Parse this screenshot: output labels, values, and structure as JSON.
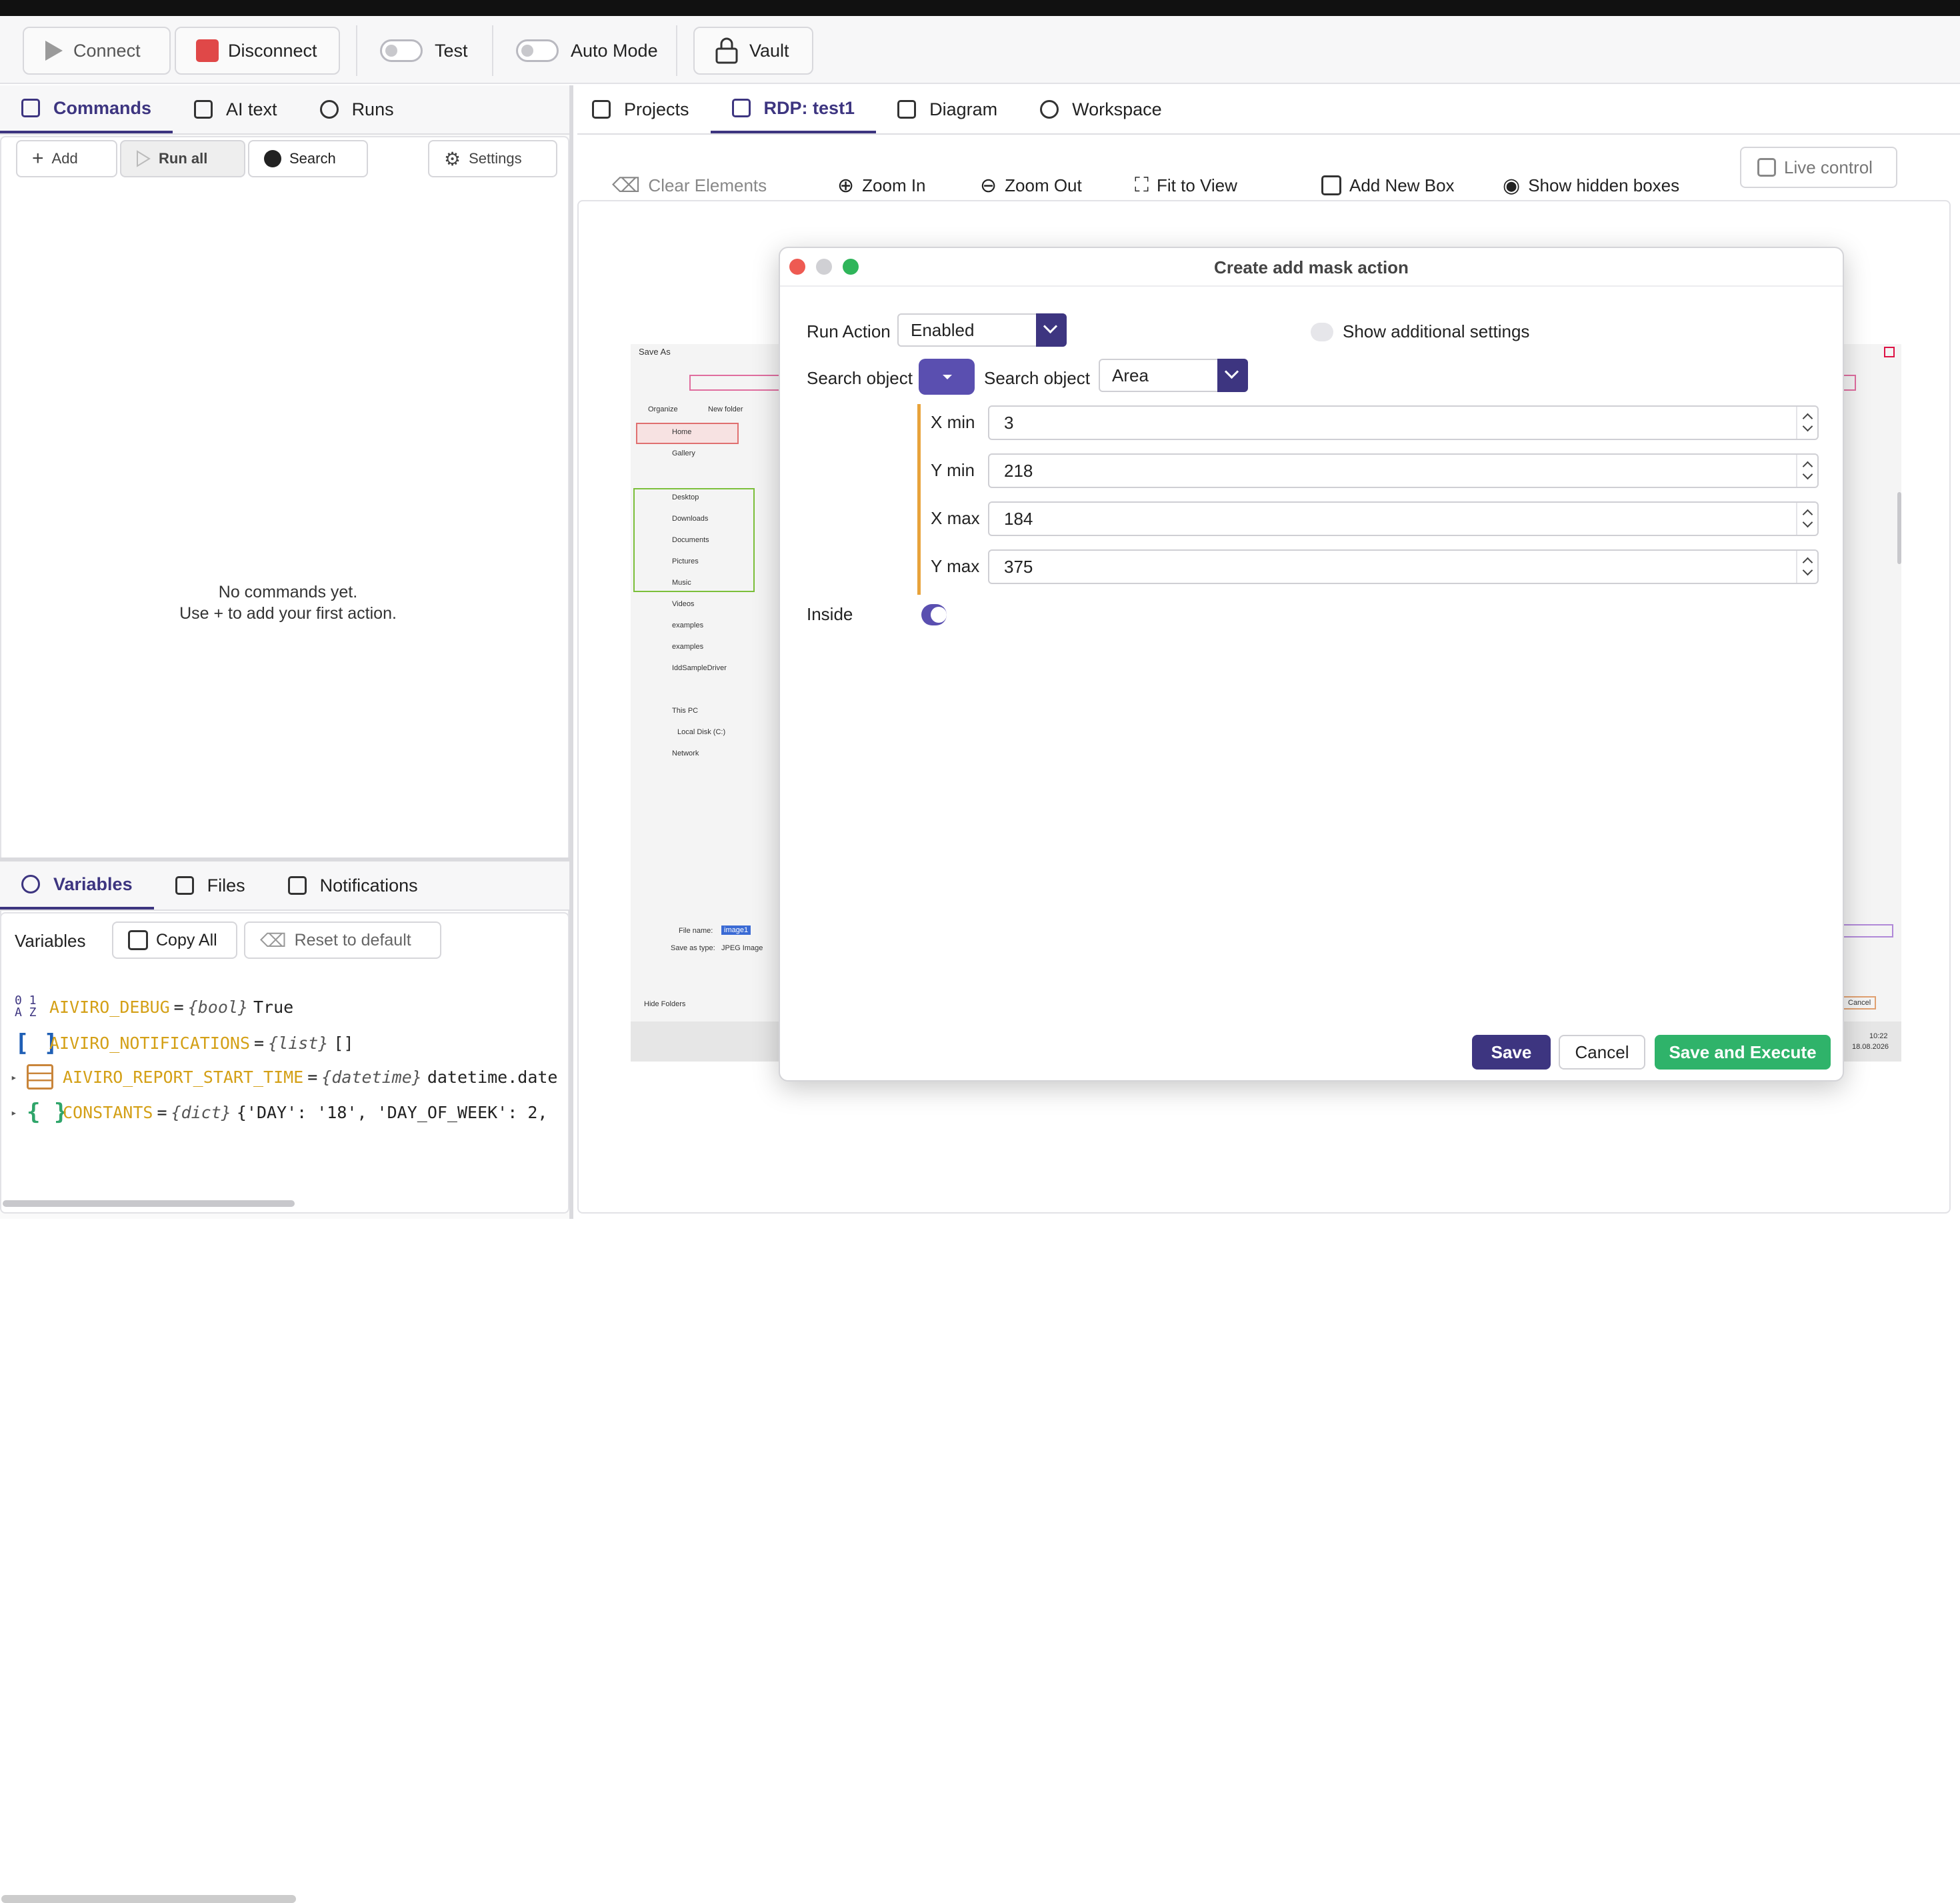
{
  "toolbar": {
    "connect": "Connect",
    "disconnect": "Disconnect",
    "test": "Test",
    "auto_mode": "Auto Mode",
    "vault": "Vault"
  },
  "left_tabs": [
    "Commands",
    "AI text",
    "Runs"
  ],
  "commands_toolbar": {
    "add": "Add",
    "run_all": "Run all",
    "search": "Search",
    "settings": "Settings"
  },
  "commands_empty": [
    "No commands yet.",
    "Use + to add your first action."
  ],
  "bottom_tabs": [
    "Variables",
    "Files",
    "Notifications"
  ],
  "variables_bar": {
    "label": "Variables",
    "copy_all": "Copy All",
    "reset": "Reset to default"
  },
  "variables": [
    {
      "icon": "0 1 A Z",
      "name": "AIVIRO_DEBUG",
      "eq": "=",
      "type": "{bool}",
      "value": "True",
      "color": "#d4a017"
    },
    {
      "icon": "[ ]",
      "name": "AIVIRO_NOTIFICATIONS",
      "eq": "=",
      "type": "{list}",
      "value": "[]",
      "color": "#d4a017"
    },
    {
      "icon": "table-icon",
      "name": "AIVIRO_REPORT_START_TIME",
      "eq": "=",
      "type": "{datetime}",
      "value": "datetime.date",
      "color": "#d4a017"
    },
    {
      "icon": "{ }",
      "name": "CONSTANTS",
      "eq": "=",
      "type": "{dict}",
      "value": "{'DAY': '18', 'DAY_OF_WEEK': 2,",
      "color": "#d4a017"
    }
  ],
  "right_tabs": [
    "Projects",
    "RDP: test1",
    "Diagram",
    "Workspace"
  ],
  "canvas_toolbar": {
    "clear": "Clear Elements",
    "zoom_in": "Zoom In",
    "zoom_out": "Zoom Out",
    "fit": "Fit to View",
    "add_box": "Add New Box",
    "show_hidden": "Show hidden boxes",
    "live": "Live control"
  },
  "dialog": {
    "title": "Create add mask action",
    "run_action_label": "Run Action",
    "run_action_value": "Enabled",
    "show_additional": "Show additional settings",
    "search_object_label": "Search object",
    "search_object_label2": "Search object",
    "search_object_value": "Area",
    "fields": [
      {
        "label": "X min",
        "value": "3"
      },
      {
        "label": "Y min",
        "value": "218"
      },
      {
        "label": "X max",
        "value": "184"
      },
      {
        "label": "Y max",
        "value": "375"
      }
    ],
    "inside_label": "Inside",
    "inside_on": true,
    "save": "Save",
    "cancel": "Cancel",
    "save_execute": "Save and Execute"
  },
  "screenshot": {
    "window_title": "Save As",
    "organize": "Organize",
    "new_folder": "New folder",
    "nav": [
      "Home",
      "Gallery",
      "Desktop",
      "Downloads",
      "Documents",
      "Pictures",
      "Music",
      "Videos",
      "examples",
      "examples",
      "IddSampleDriver",
      "This PC",
      "Local Disk (C:)",
      "Network"
    ],
    "file_name_label": "File name:",
    "file_name_value": "image1",
    "save_type_label": "Save as type:",
    "save_type_value": "JPEG Image",
    "hide_folders": "Hide Folders",
    "cancel": "Cancel",
    "time": "10:22",
    "date": "18.08.2026"
  },
  "colors": {
    "accent": "#3d3580",
    "green": "#2fb36a",
    "disconnect": "#e04848",
    "var_name": "#d4a017"
  }
}
